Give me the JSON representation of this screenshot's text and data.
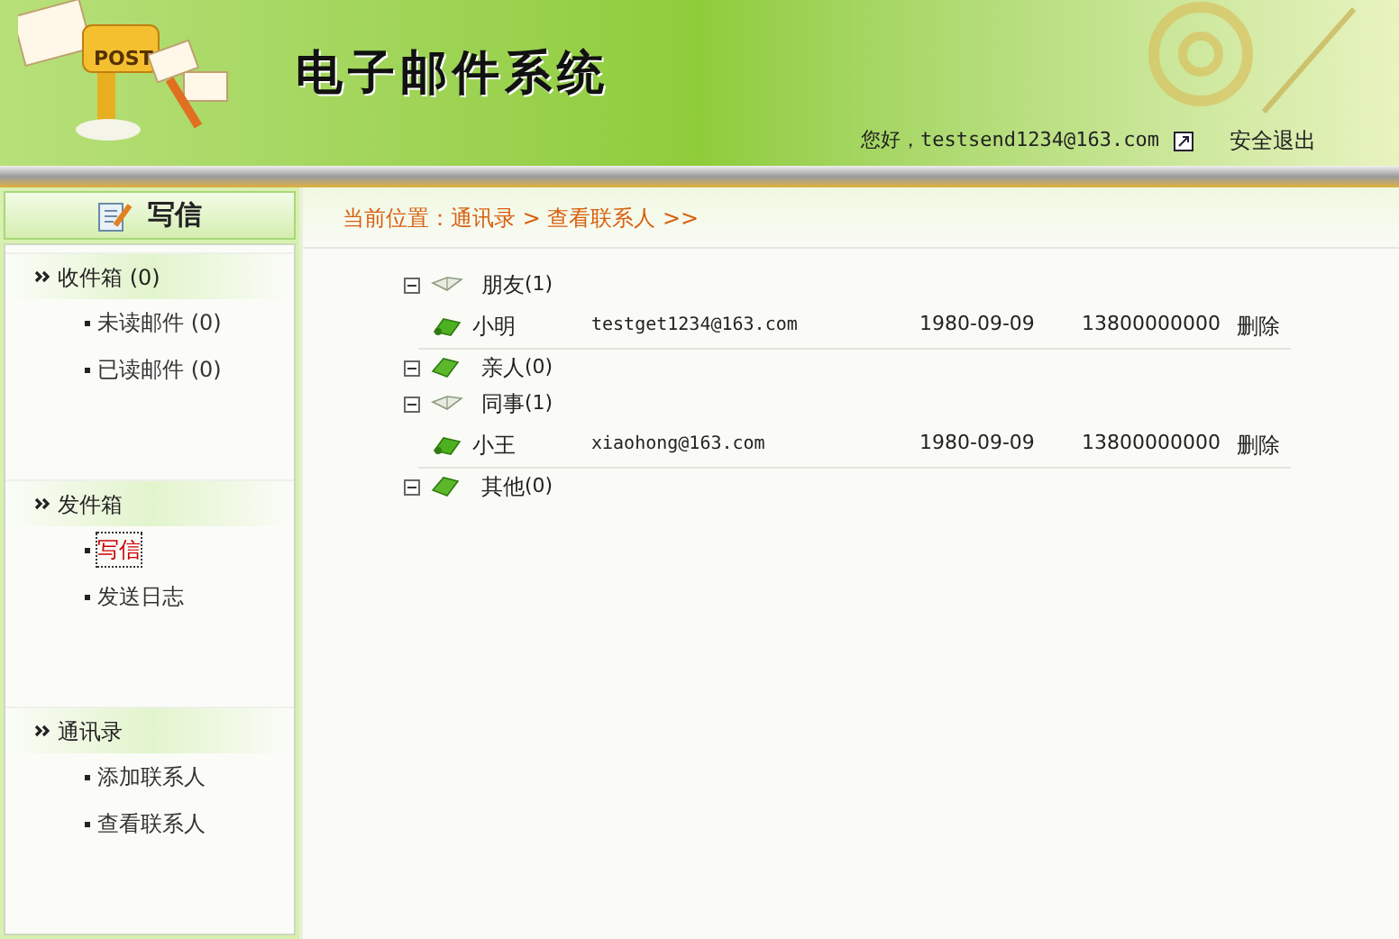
{
  "header": {
    "logo_text": "POST",
    "title": "电子邮件系统",
    "greeting": "您好，testsend1234@163.com",
    "logout": "安全退出"
  },
  "sidebar": {
    "compose": "写信",
    "sections": [
      {
        "title": "收件箱 (0)",
        "items": [
          {
            "label": "未读邮件 (0)",
            "focused": false
          },
          {
            "label": "已读邮件 (0)",
            "focused": false
          }
        ]
      },
      {
        "title": "发件箱",
        "items": [
          {
            "label": "写信",
            "focused": true
          },
          {
            "label": "发送日志",
            "focused": false
          }
        ]
      },
      {
        "title": "通讯录",
        "items": [
          {
            "label": "添加联系人",
            "focused": false
          },
          {
            "label": "查看联系人",
            "focused": false
          }
        ]
      }
    ]
  },
  "breadcrumb": "当前位置：通讯录 > 查看联系人 >>",
  "groups": [
    {
      "name": "朋友",
      "count": "(1)",
      "expanded": true,
      "contacts": [
        {
          "name": "小明",
          "email": "testget1234@163.com",
          "birthday": "1980-09-09",
          "phone": "13800000000",
          "action": "删除"
        }
      ]
    },
    {
      "name": "亲人",
      "count": "(0)",
      "expanded": false
    },
    {
      "name": "同事",
      "count": "(1)",
      "expanded": true,
      "contacts": [
        {
          "name": "小王",
          "email": "xiaohong@163.com",
          "birthday": "1980-09-09",
          "phone": "13800000000",
          "action": "删除"
        }
      ]
    },
    {
      "name": "其他",
      "count": "(0)",
      "expanded": false
    }
  ]
}
